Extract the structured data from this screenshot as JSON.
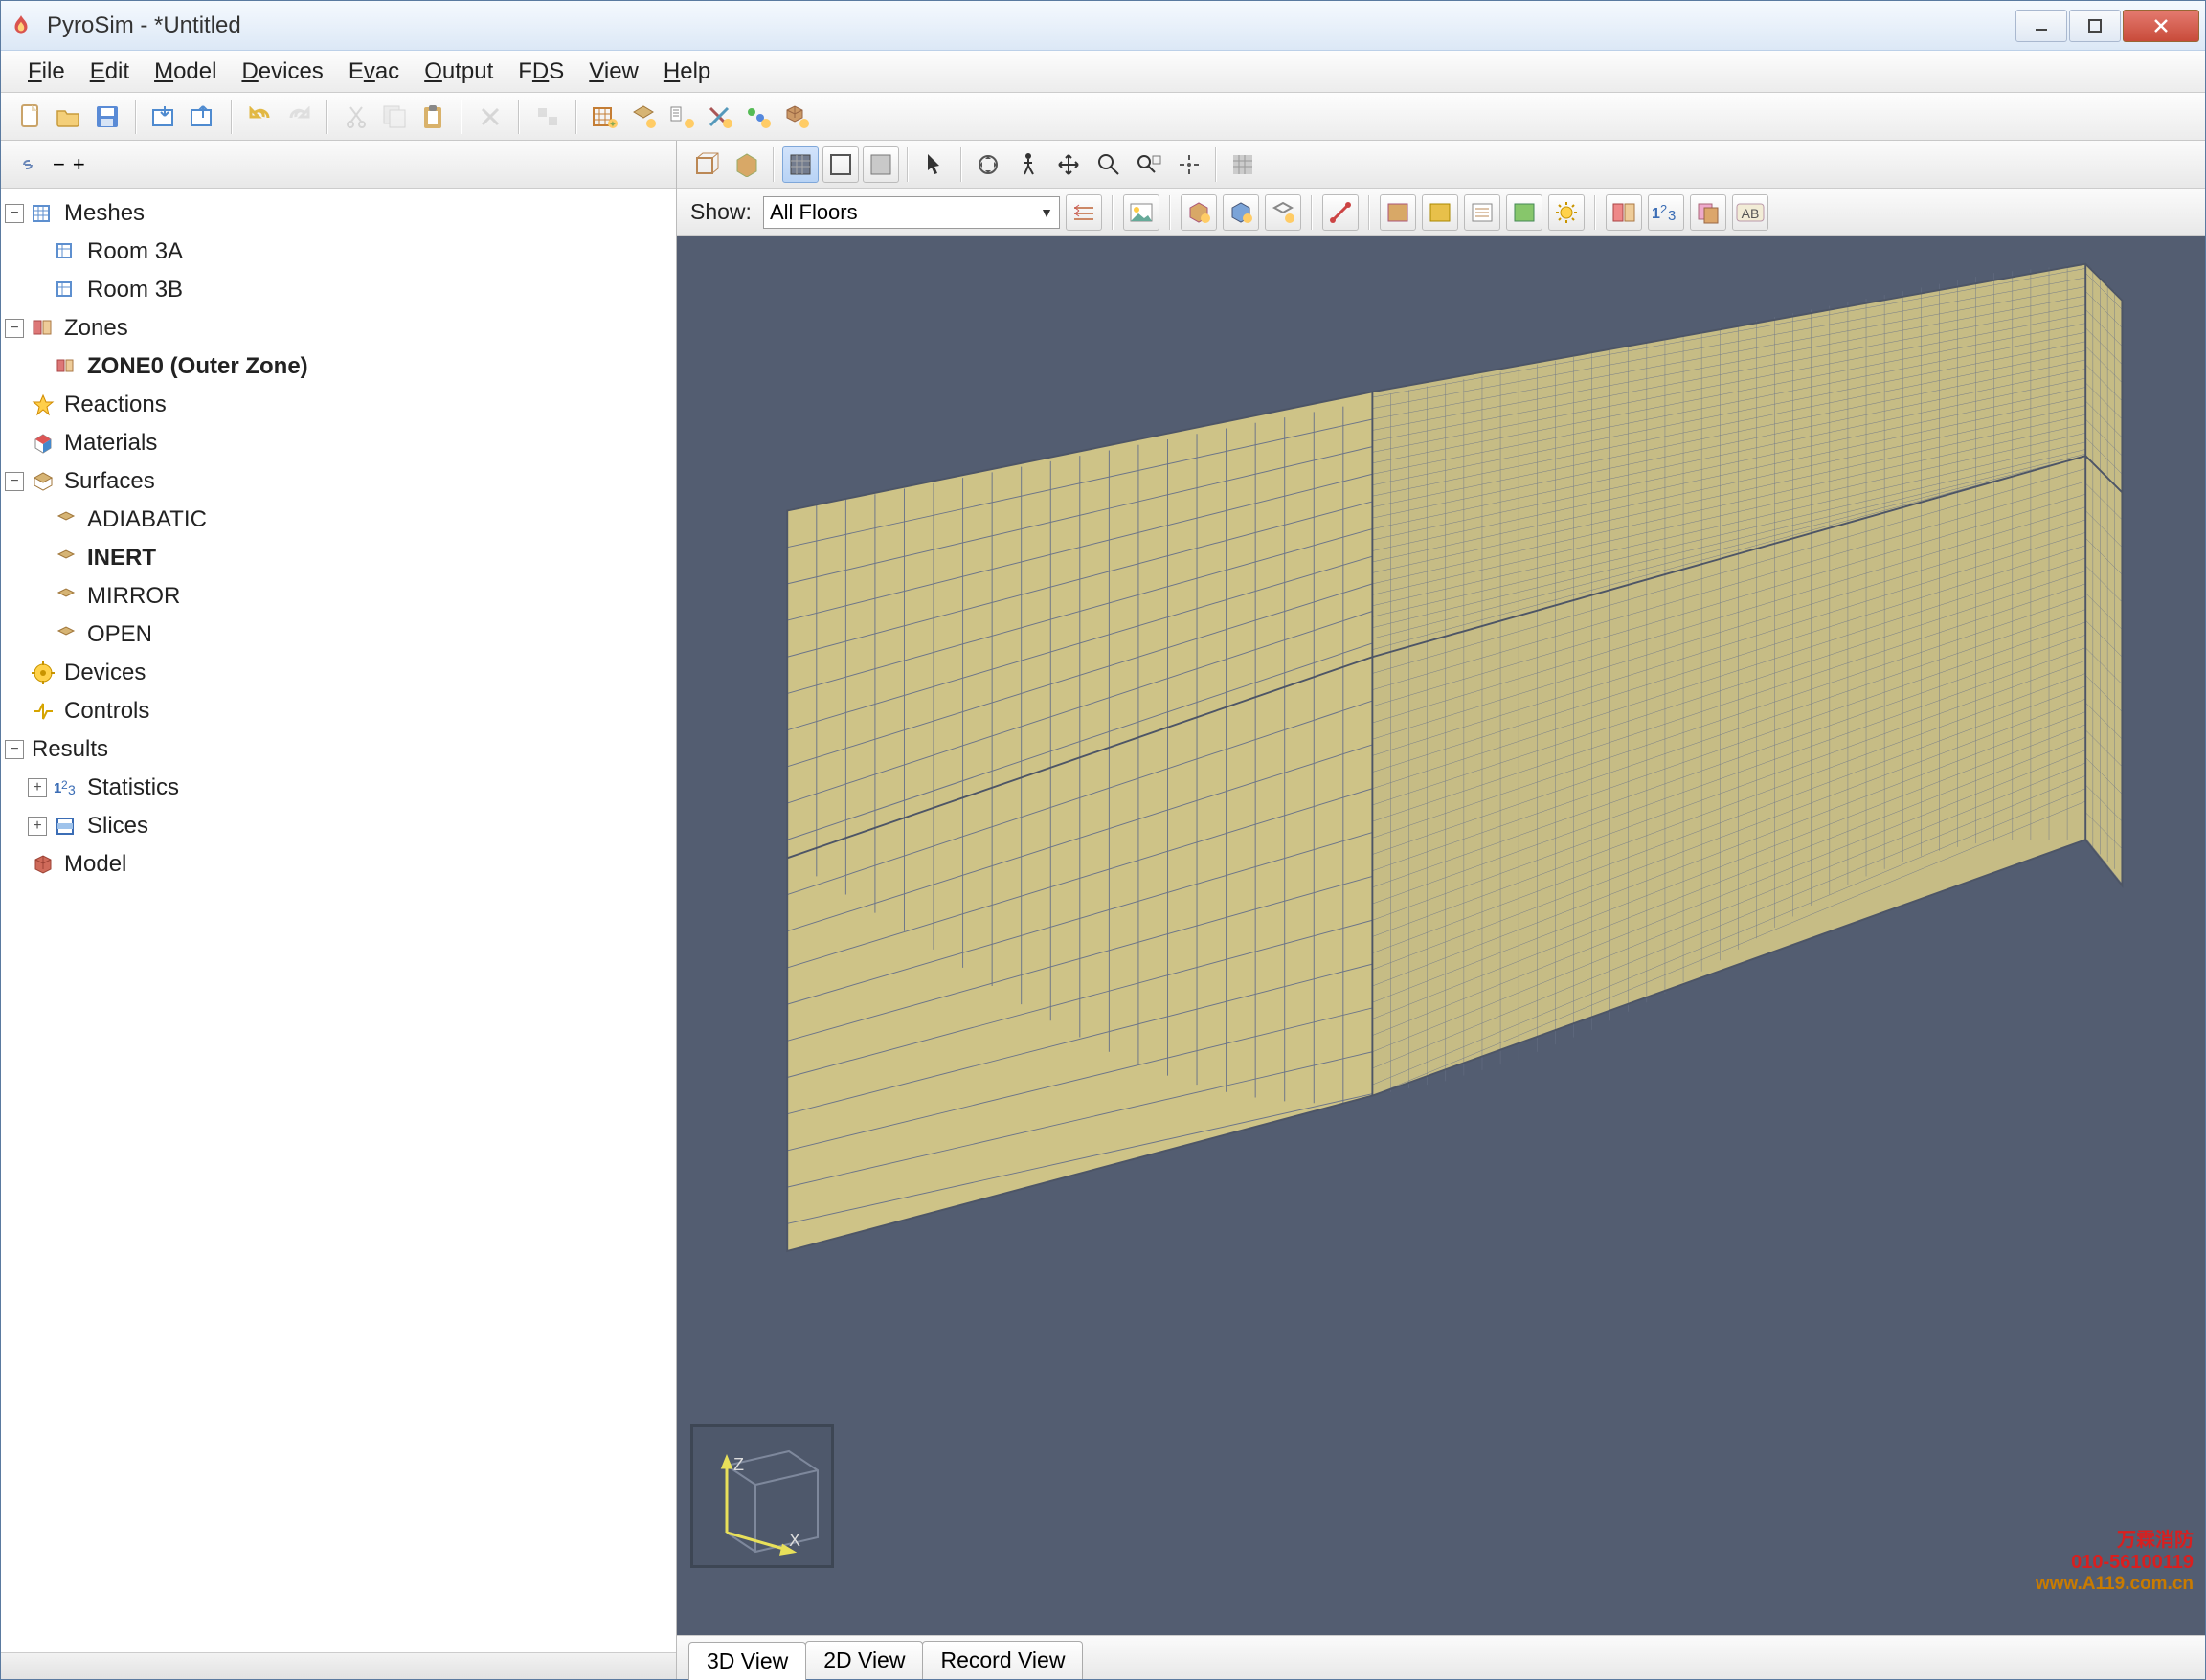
{
  "window": {
    "title": "PyroSim - *Untitled"
  },
  "menu": {
    "items": [
      "File",
      "Edit",
      "Model",
      "Devices",
      "Evac",
      "Output",
      "FDS",
      "View",
      "Help"
    ]
  },
  "tree": {
    "meshes": {
      "label": "Meshes",
      "children": [
        "Room 3A",
        "Room 3B"
      ]
    },
    "zones": {
      "label": "Zones",
      "children": [
        "ZONE0 (Outer Zone)"
      ]
    },
    "reactions": {
      "label": "Reactions"
    },
    "materials": {
      "label": "Materials"
    },
    "surfaces": {
      "label": "Surfaces",
      "children": [
        "ADIABATIC",
        "INERT",
        "MIRROR",
        "OPEN"
      ]
    },
    "devices": {
      "label": "Devices"
    },
    "controls": {
      "label": "Controls"
    },
    "results": {
      "label": "Results",
      "children": [
        "Statistics",
        "Slices"
      ]
    },
    "model": {
      "label": "Model"
    }
  },
  "viewport": {
    "show_label": "Show:",
    "floor_selected": "All Floors",
    "tabs": [
      "3D View",
      "2D View",
      "Record View"
    ],
    "active_tab": "3D View",
    "axis": {
      "x": "X",
      "z": "Z"
    }
  },
  "watermark": {
    "line1": "万霖消防",
    "line2": "010-56100119",
    "line3": "www.A119.com.cn"
  }
}
